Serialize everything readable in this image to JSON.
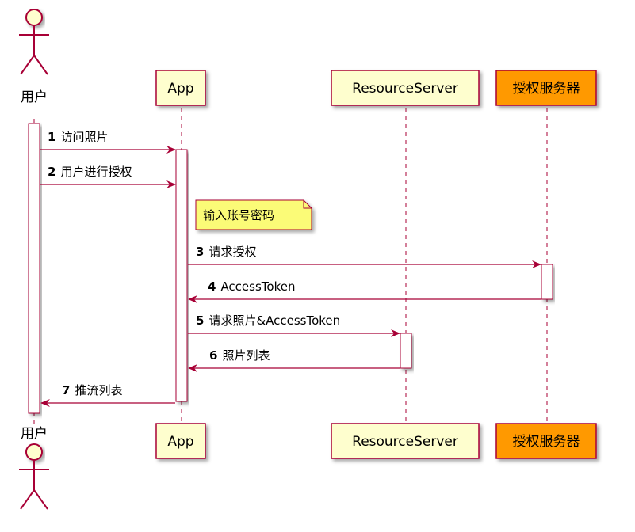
{
  "colors": {
    "participant_fill": "#FEFECE",
    "auth_fill": "#FF9900",
    "border": "#A80036",
    "note_fill": "#FBFB77",
    "note_border": "#A80036"
  },
  "participants": [
    {
      "id": "user",
      "label": "用户",
      "kind": "actor"
    },
    {
      "id": "app",
      "label": "App",
      "kind": "box"
    },
    {
      "id": "resource",
      "label": "ResourceServer",
      "kind": "box"
    },
    {
      "id": "auth",
      "label": "授权服务器",
      "kind": "box-highlight"
    }
  ],
  "note": {
    "text": "输入账号密码"
  },
  "messages": [
    {
      "num": "1",
      "text": "访问照片"
    },
    {
      "num": "2",
      "text": "用户进行授权"
    },
    {
      "num": "3",
      "text": "请求授权"
    },
    {
      "num": "4",
      "text": "AccessToken"
    },
    {
      "num": "5",
      "text": "请求照片&AccessToken"
    },
    {
      "num": "6",
      "text": "照片列表"
    },
    {
      "num": "7",
      "text": "推流列表"
    }
  ]
}
